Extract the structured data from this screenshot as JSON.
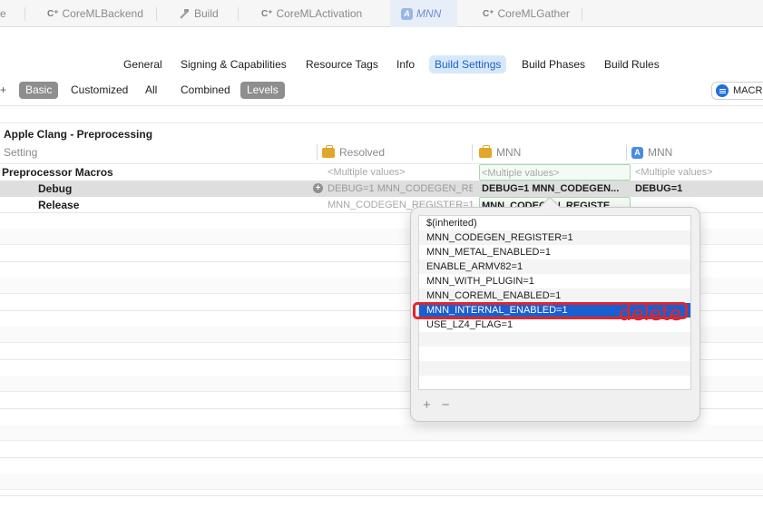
{
  "tabs": {
    "partial": "e",
    "items": [
      {
        "label": "CoreMLBackend",
        "prefix": "C⁺"
      },
      {
        "label": "Build"
      },
      {
        "label": "CoreMLActivation",
        "prefix": "C⁺"
      },
      {
        "label": "MNN"
      },
      {
        "label": "CoreMLGather",
        "prefix": "C⁺"
      }
    ]
  },
  "editor_tabs": [
    "General",
    "Signing & Capabilities",
    "Resource Tags",
    "Info",
    "Build Settings",
    "Build Phases",
    "Build Rules"
  ],
  "filters": {
    "plus": "+",
    "scope": [
      "Basic",
      "Customized",
      "All"
    ],
    "view": [
      "Combined",
      "Levels"
    ],
    "search_value": "MACR"
  },
  "section": {
    "title": "Apple Clang - Preprocessing",
    "col_setting": "Setting",
    "col_resolved": "Resolved",
    "col_project": "MNN",
    "col_target": "MNN"
  },
  "rows": {
    "macros": {
      "label": "Preprocessor Macros",
      "resolved": "<Multiple values>",
      "project": "<Multiple values>",
      "target": "<Multiple values>"
    },
    "debug": {
      "label": "Debug",
      "resolved": "DEBUG=1  MNN_CODEGEN_RE...",
      "project": "DEBUG=1  MNN_CODEGEN...",
      "target": "DEBUG=1"
    },
    "release": {
      "label": "Release",
      "resolved": "MNN_CODEGEN_REGISTER=1 ...",
      "project": "MNN_CODEGEN_REGISTE..."
    }
  },
  "popover": {
    "items": [
      "$(inherited)",
      "MNN_CODEGEN_REGISTER=1",
      "MNN_METAL_ENABLED=1",
      "ENABLE_ARMV82=1",
      "MNN_WITH_PLUGIN=1",
      "MNN_COREML_ENABLED=1",
      "MNN_INTERNAL_ENABLED=1",
      "USE_LZ4_FLAG=1"
    ],
    "selected_index": 6,
    "add_label": "+",
    "remove_label": "−",
    "annotation": "delete"
  },
  "colors": {
    "selection": "#1a5fd0",
    "annotation": "#e0262a",
    "active_tab": "#d7e8fb"
  }
}
